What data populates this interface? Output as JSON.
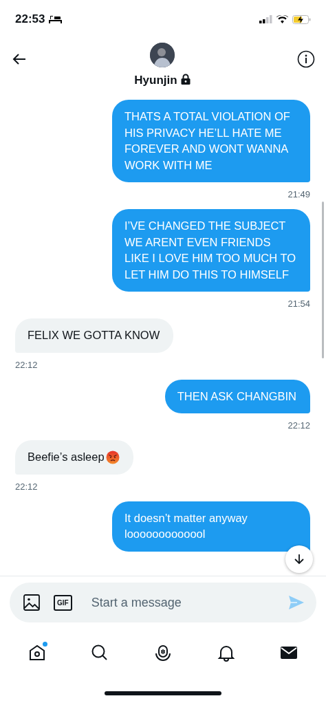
{
  "status_bar": {
    "time": "22:53"
  },
  "header": {
    "name": "Hyunjin",
    "protected": true
  },
  "messages": [
    {
      "kind": "sent",
      "text": "THATS A TOTAL VIOLATION OF HIS PRIVACY HE’LL HATE ME FOREVER AND WONT WANNA WORK WITH ME",
      "time": "21:49"
    },
    {
      "kind": "sent",
      "text": "I’VE CHANGED THE SUBJECT WE ARENT EVEN FRIENDS LIKE I LOVE HIM TOO MUCH TO LET HIM DO THIS TO HIMSELF",
      "time": "21:54"
    },
    {
      "kind": "received",
      "text": "FELIX WE GOTTA KNOW",
      "time": "22:12"
    },
    {
      "kind": "sent",
      "text": "THEN ASK CHANGBIN",
      "time": "22:12"
    },
    {
      "kind": "received",
      "text": "Beefie’s asleep",
      "angry_emoji": true,
      "time": "22:12"
    },
    {
      "kind": "sent",
      "text": "It doesn’t matter anyway looooooooooool"
    }
  ],
  "composer": {
    "placeholder": "Start a message",
    "gif_label": "GIF"
  },
  "nav": [
    {
      "kind": "home",
      "selected": false,
      "dot": true
    },
    {
      "kind": "search",
      "selected": false,
      "dot": false
    },
    {
      "kind": "spaces",
      "selected": false,
      "dot": false
    },
    {
      "kind": "notifications",
      "selected": false,
      "dot": false
    },
    {
      "kind": "messages",
      "selected": true,
      "dot": false
    }
  ]
}
